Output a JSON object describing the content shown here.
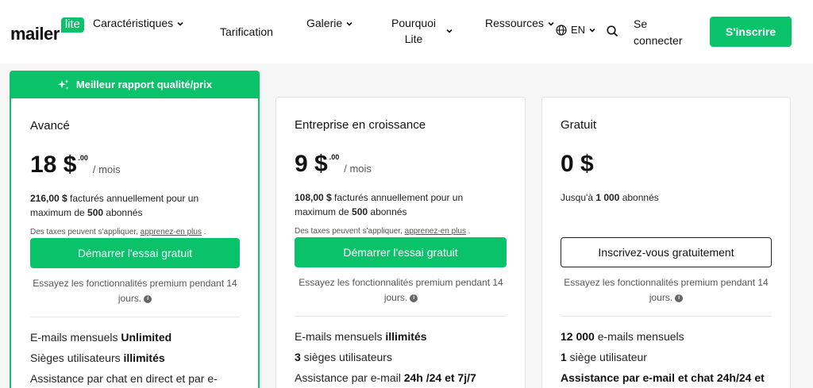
{
  "header": {
    "logo_text": "mailer",
    "logo_badge": "lite",
    "nav": {
      "features": "Caractéristiques",
      "pricing": "Tarification",
      "gallery": "Galerie",
      "why_line1": "Pourquoi",
      "why_line2": "Lite",
      "resources": "Ressources"
    },
    "lang": "EN",
    "login_line1": "Se",
    "login_line2": "connecter",
    "signup": "S'inscrire"
  },
  "ribbon": "Meilleur rapport qualité/prix",
  "plans": [
    {
      "name": "Avancé",
      "price": "18 $",
      "price_sup": ".00",
      "per": "/ mois",
      "billing_amount": "216,00 $",
      "billing_text": " facturés annuellement pour un",
      "billing_text2": "maximum de ",
      "billing_subs": "500",
      "billing_end": " abonnés",
      "tax_text": "Des taxes peuvent s'appliquer, ",
      "tax_link": "apprenez-en plus",
      "tax_end": " .",
      "cta": "Démarrer l'essai gratuit",
      "trial": "Essayez les fonctionnalités premium pendant 14",
      "trial2": "jours.",
      "f1_text": "E-mails mensuels ",
      "f1_bold": "Unlimited",
      "f2_text": "Sièges utilisateurs ",
      "f2_bold": "illimités",
      "f3_text": "Assistance par chat en direct et par e-"
    },
    {
      "name": "Entreprise en croissance",
      "price": "9 $",
      "price_sup": ".00",
      "per": "/ mois",
      "billing_amount": "108,00 $",
      "billing_text": " facturés annuellement pour un",
      "billing_text2": "maximum de ",
      "billing_subs": "500",
      "billing_end": " abonnés",
      "tax_text": "Des taxes peuvent s'appliquer, ",
      "tax_link": "apprenez-en plus",
      "tax_end": " .",
      "cta": "Démarrer l'essai gratuit",
      "trial": "Essayez les fonctionnalités premium pendant 14",
      "trial2": "jours.",
      "f1_text": "E-mails mensuels ",
      "f1_bold": "illimités",
      "f2_bold": "3",
      "f2_text": " sièges utilisateurs",
      "f3_text": "Assistance par e-mail ",
      "f3_bold": "24h /24 et 7j/7"
    },
    {
      "name": "Gratuit",
      "price": "0 $",
      "billing_text": "Jusqu'à ",
      "billing_subs": "1 000",
      "billing_end": " abonnés",
      "cta": "Inscrivez-vous gratuitement",
      "trial": "Essayez les fonctionnalités premium pendant 14",
      "trial2": "jours.",
      "f1_bold": "12 000",
      "f1_text": " e-mails mensuels",
      "f2_bold": "1",
      "f2_text": " siège utilisateur",
      "f3_bold": "Assistance par e-mail et chat 24h/24 et"
    }
  ],
  "colors": {
    "accent": "#09c269"
  }
}
